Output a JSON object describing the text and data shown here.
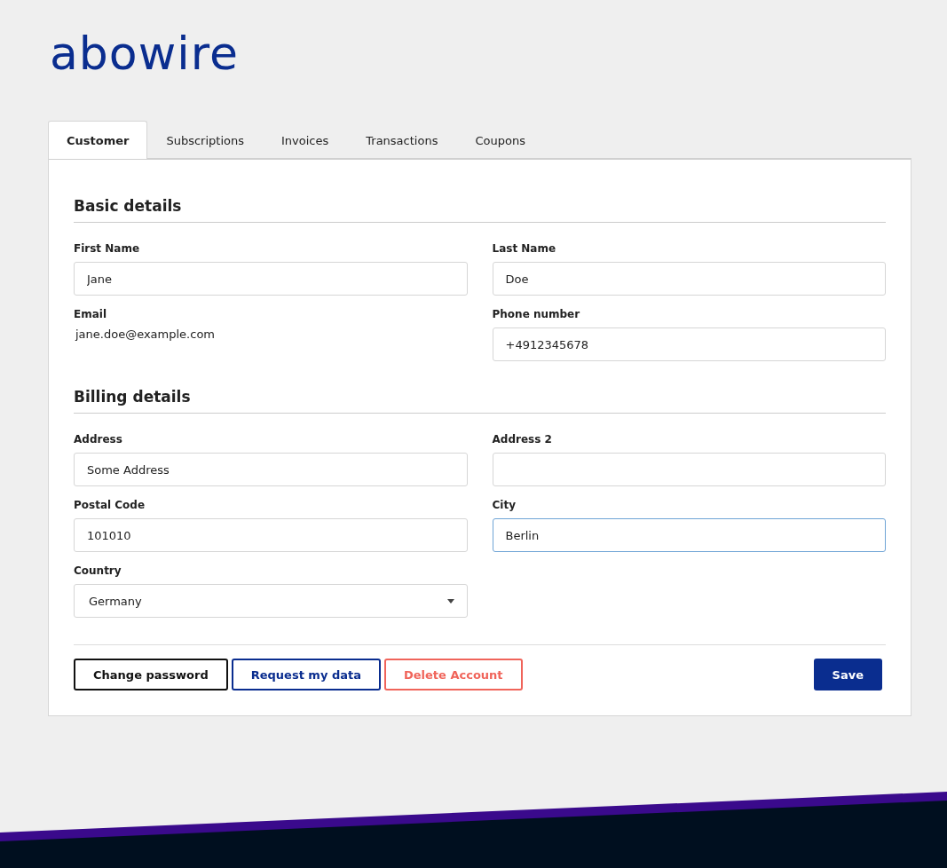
{
  "logo": {
    "text": "abowire"
  },
  "tabs": [
    {
      "label": "Customer",
      "selected": true
    },
    {
      "label": "Subscriptions",
      "selected": false
    },
    {
      "label": "Invoices",
      "selected": false
    },
    {
      "label": "Transactions",
      "selected": false
    },
    {
      "label": "Coupons",
      "selected": false
    }
  ],
  "sections": [
    {
      "title": "Basic details",
      "fields": [
        {
          "label": "First Name",
          "kind": "input",
          "value": "Jane",
          "focused": false
        },
        {
          "label": "Last Name",
          "kind": "input",
          "value": "Doe",
          "focused": false
        },
        {
          "label": "Email",
          "kind": "text",
          "value": "jane.doe@example.com"
        },
        {
          "label": "Phone number",
          "kind": "input",
          "value": "+4912345678",
          "focused": false
        }
      ]
    },
    {
      "title": "Billing details",
      "fields": [
        {
          "label": "Address",
          "kind": "input",
          "value": "Some Address",
          "focused": false
        },
        {
          "label": "Address 2",
          "kind": "input",
          "focused": false
        },
        {
          "label": "Postal Code",
          "kind": "input",
          "value": "101010",
          "focused": false
        },
        {
          "label": "City",
          "kind": "input",
          "value": "Berlin",
          "focused": true
        },
        {
          "label": "Country",
          "kind": "select",
          "value": "Germany"
        }
      ]
    }
  ],
  "actions": [
    {
      "label": "Change password",
      "kind": "outline"
    },
    {
      "label": "Request my data",
      "kind": "primary-outline"
    },
    {
      "label": "Delete Account",
      "kind": "danger-outline"
    }
  ],
  "save_button": {
    "label": "Save"
  }
}
